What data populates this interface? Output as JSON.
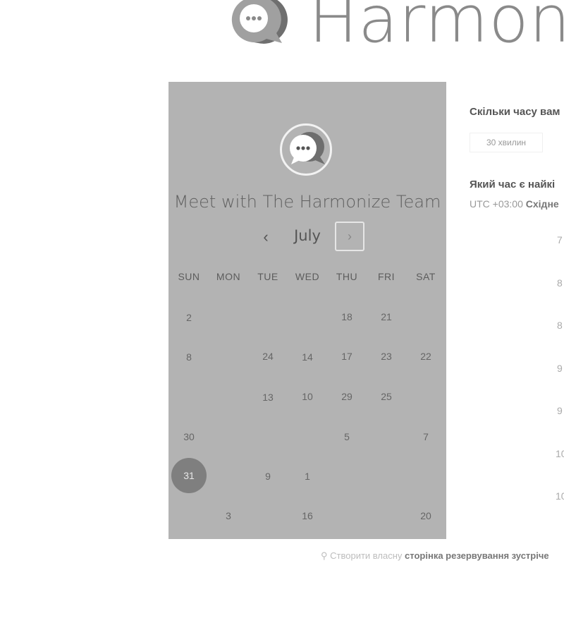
{
  "brand": {
    "name": "Harmon"
  },
  "meeting": {
    "title": "Meet with The Harmonize Team"
  },
  "calendar": {
    "month": "July",
    "prev_label": "‹",
    "next_label": "›",
    "weekdays": [
      "SUN",
      "MON",
      "TUE",
      "WED",
      "THU",
      "FRI",
      "SAT"
    ],
    "rows": [
      [
        "2",
        "",
        "",
        "",
        "18",
        "21",
        ""
      ],
      [
        "8",
        "",
        "24",
        "14",
        "17",
        "23",
        "22"
      ],
      [
        "",
        "",
        "13",
        "10",
        "29",
        "25",
        ""
      ],
      [
        "30",
        "",
        "",
        "",
        "5",
        "",
        "7"
      ],
      [
        "31",
        "",
        "9",
        "1",
        "",
        "",
        ""
      ],
      [
        "",
        "3",
        "",
        "16",
        "",
        "",
        "20"
      ]
    ],
    "selected_day": "31"
  },
  "right": {
    "duration_question": "Скільки часу вам",
    "duration_option": "30 хвилин",
    "time_question": "Який час є найкі",
    "timezone_offset": "UTC +03:00",
    "timezone_name": "Східне",
    "slots": [
      "7",
      "8",
      "8",
      "9",
      "9",
      "10",
      "10"
    ]
  },
  "footer": {
    "prefix": "Створити власну",
    "link": "сторінка резервування зустріче"
  },
  "colors": {
    "card_bg": "#b3b3b3",
    "selected_day_bg": "#7f7f7f",
    "logo": "#8a8a8a"
  }
}
